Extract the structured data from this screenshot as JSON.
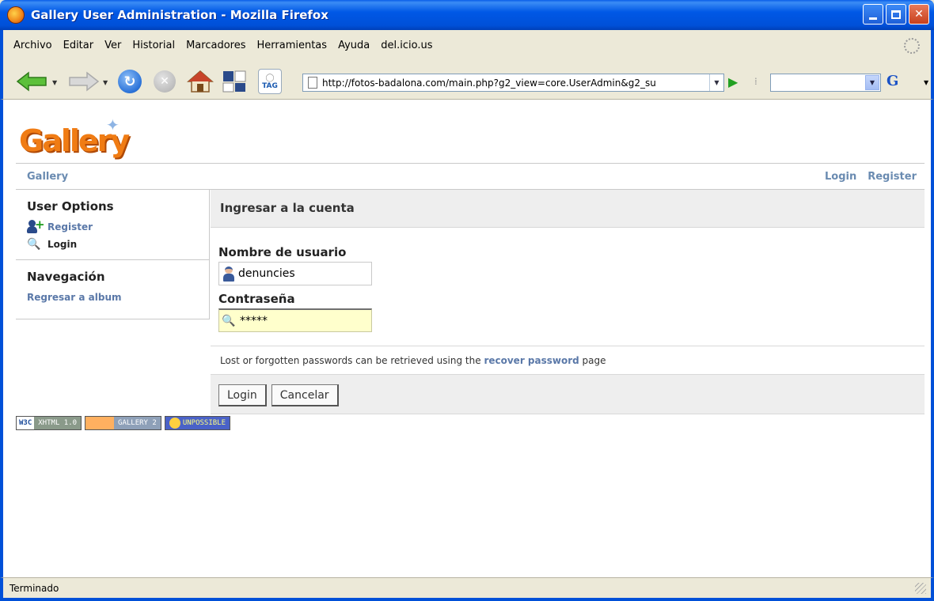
{
  "window": {
    "title": "Gallery User Administration - Mozilla Firefox"
  },
  "menu": {
    "items": [
      "Archivo",
      "Editar",
      "Ver",
      "Historial",
      "Marcadores",
      "Herramientas",
      "Ayuda",
      "del.icio.us"
    ]
  },
  "toolbar": {
    "url": "http://fotos-badalona.com/main.php?g2_view=core.UserAdmin&g2_su",
    "search_value": "",
    "tag_label": "TAG",
    "google_label": "G"
  },
  "gallery": {
    "logo_text": "Gallery",
    "breadcrumb": "Gallery",
    "top_links": {
      "login": "Login",
      "register": "Register"
    }
  },
  "sidebar": {
    "user_options_heading": "User Options",
    "register_link": "Register",
    "login_current": "Login",
    "nav_heading": "Navegación",
    "back_link": "Regresar a album"
  },
  "login_form": {
    "heading": "Ingresar a la cuenta",
    "username_label": "Nombre de usuario",
    "username_value": "denuncies",
    "password_label": "Contraseña",
    "password_value": "*****",
    "recover_prefix": "Lost or forgotten passwords can be retrieved using the",
    "recover_link": "recover password",
    "recover_suffix": "page",
    "login_button": "Login",
    "cancel_button": "Cancelar"
  },
  "badges": {
    "w3c_left": "W3C",
    "w3c_right": "XHTML 1.0",
    "gallery_right": "GALLERY 2",
    "unpossible": "UNPOSSIBLE"
  },
  "status": {
    "text": "Terminado"
  },
  "colors": {
    "titlebar": "#0050d8",
    "link": "#6a8bb1",
    "logo": "#f07c14",
    "active_input": "#ffffcc"
  }
}
